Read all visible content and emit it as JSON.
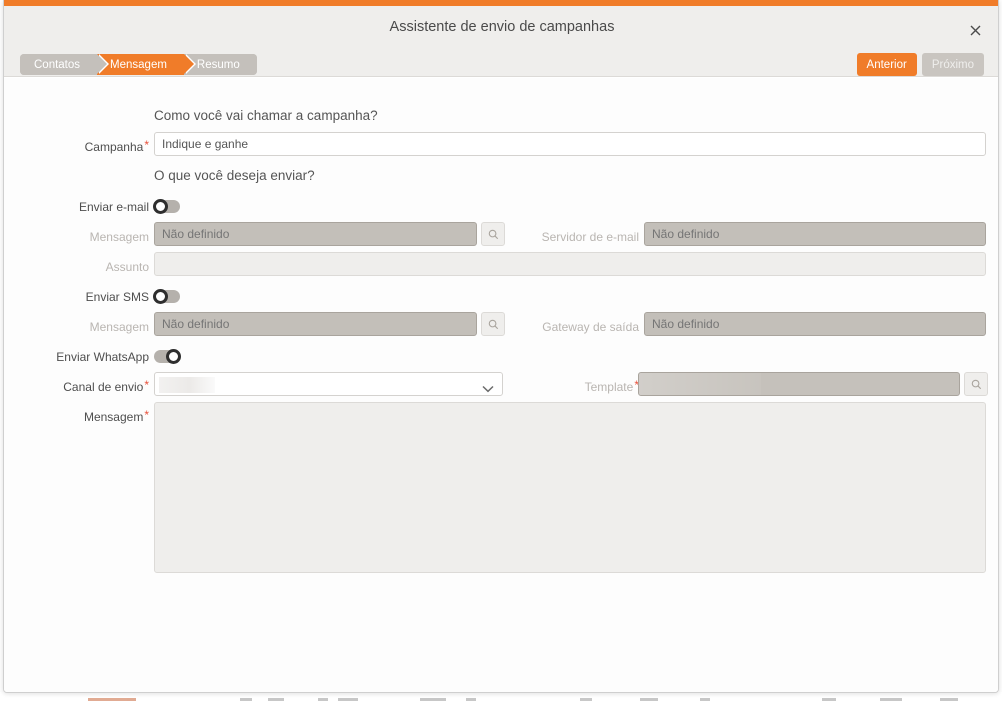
{
  "window": {
    "title": "Assistente de envio de campanhas",
    "close_icon": "close-icon",
    "accent_color": "#f07c29"
  },
  "steps": [
    {
      "label": "Contatos",
      "active": false
    },
    {
      "label": "Mensagem",
      "active": true
    },
    {
      "label": "Resumo",
      "active": false
    }
  ],
  "nav": {
    "previous_label": "Anterior",
    "next_label": "Próximo"
  },
  "sections": {
    "name_title": "Como você vai chamar a campanha?",
    "send_title": "O que você deseja enviar?"
  },
  "campaign": {
    "label": "Campanha",
    "required": "*",
    "value": "Indique e ganhe"
  },
  "email": {
    "toggle_label": "Enviar e-mail",
    "toggle_on": false,
    "message_label": "Mensagem",
    "message_placeholder": "Não definido",
    "search_icon": "search-icon",
    "server_label": "Servidor de e-mail",
    "server_placeholder": "Não definido",
    "subject_label": "Assunto",
    "subject_value": ""
  },
  "sms": {
    "toggle_label": "Enviar SMS",
    "toggle_on": false,
    "message_label": "Mensagem",
    "message_placeholder": "Não definido",
    "search_icon": "search-icon",
    "gateway_label": "Gateway de saída",
    "gateway_placeholder": "Não definido"
  },
  "whatsapp": {
    "toggle_label": "Enviar WhatsApp",
    "toggle_on": true,
    "channel_label": "Canal de envio",
    "channel_required": "*",
    "channel_value": "",
    "chevron_icon": "chevron-down-icon",
    "template_label": "Template",
    "template_required": "*",
    "template_value": "",
    "template_search_icon": "search-icon",
    "message_label": "Mensagem",
    "message_required": "*",
    "message_value": ""
  }
}
